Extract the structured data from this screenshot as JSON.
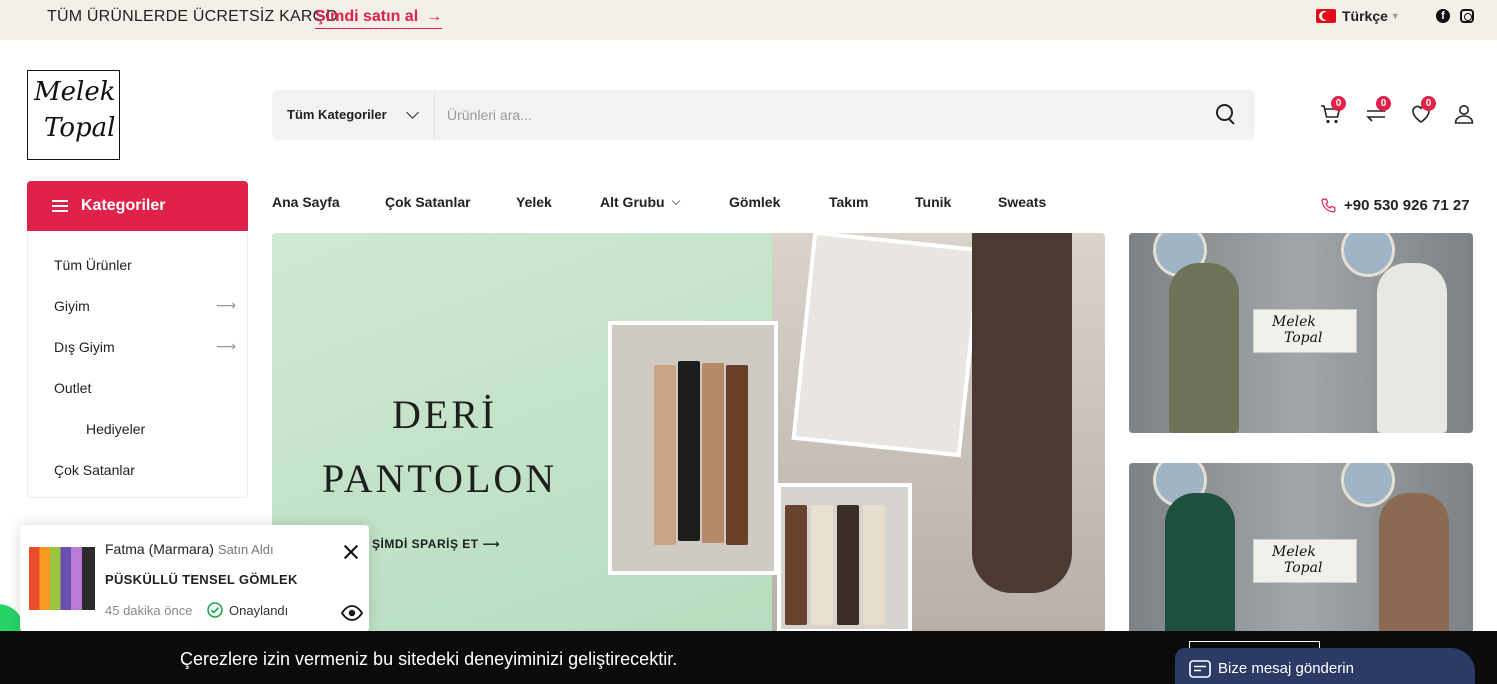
{
  "topbar": {
    "shipping_text": "TÜM ÜRÜNLERDE ÜCRETSİZ KARGO",
    "buy_now": "Şimdi satın al",
    "buy_arrow": "→",
    "language": "Türkçe",
    "social": [
      "facebook-icon",
      "instagram-icon"
    ]
  },
  "header": {
    "logo_line1": "Melek",
    "logo_line2": "Topal",
    "search": {
      "category": "Tüm Kategoriler",
      "placeholder": "Ürünleri ara..."
    },
    "cart_count": "0",
    "compare_count": "0",
    "wishlist_count": "0"
  },
  "nav": {
    "categories_label": "Kategoriler",
    "items": [
      "Ana Sayfa",
      "Çok Satanlar",
      "Yelek",
      "Alt Grubu",
      "Gömlek",
      "Takım",
      "Tunik",
      "Sweats"
    ],
    "phone": "+90 530 926 71 27"
  },
  "sidebar": {
    "items": [
      {
        "label": "Tüm Ürünler",
        "has_children": false
      },
      {
        "label": "Giyim",
        "has_children": true
      },
      {
        "label": "Dış Giyim",
        "has_children": true
      },
      {
        "label": "Outlet",
        "has_children": false
      },
      {
        "label": "Hediyeler",
        "has_children": false
      },
      {
        "label": "Çok Satanlar",
        "has_children": false
      }
    ]
  },
  "hero": {
    "title_line1": "DERİ",
    "title_line2": "PANTOLON",
    "cta": "ŞİMDİ SPARİŞ ET ⟶"
  },
  "side_banners": [
    {
      "logo_line1": "Melek",
      "logo_line2": "Topal"
    },
    {
      "logo_line1": "Melek",
      "logo_line2": "Topal"
    }
  ],
  "popup": {
    "customer": "Fatma (Marmara)",
    "action": "Satın Aldı",
    "product": "PÜSKÜLLÜ TENSEL GÖMLEK",
    "time": "45 dakika önce",
    "verified": "Onaylandı"
  },
  "cookie": {
    "message": "Çerezlere izin vermeniz bu sitedeki deneyiminizi geliştirecektir."
  },
  "chat": {
    "label": "Bize mesaj gönderin"
  },
  "colors": {
    "accent": "#e0214a",
    "topbar_bg": "#f3efe9",
    "cookie_bg": "#0b0b0b",
    "chat_bg": "#2b3b66"
  }
}
